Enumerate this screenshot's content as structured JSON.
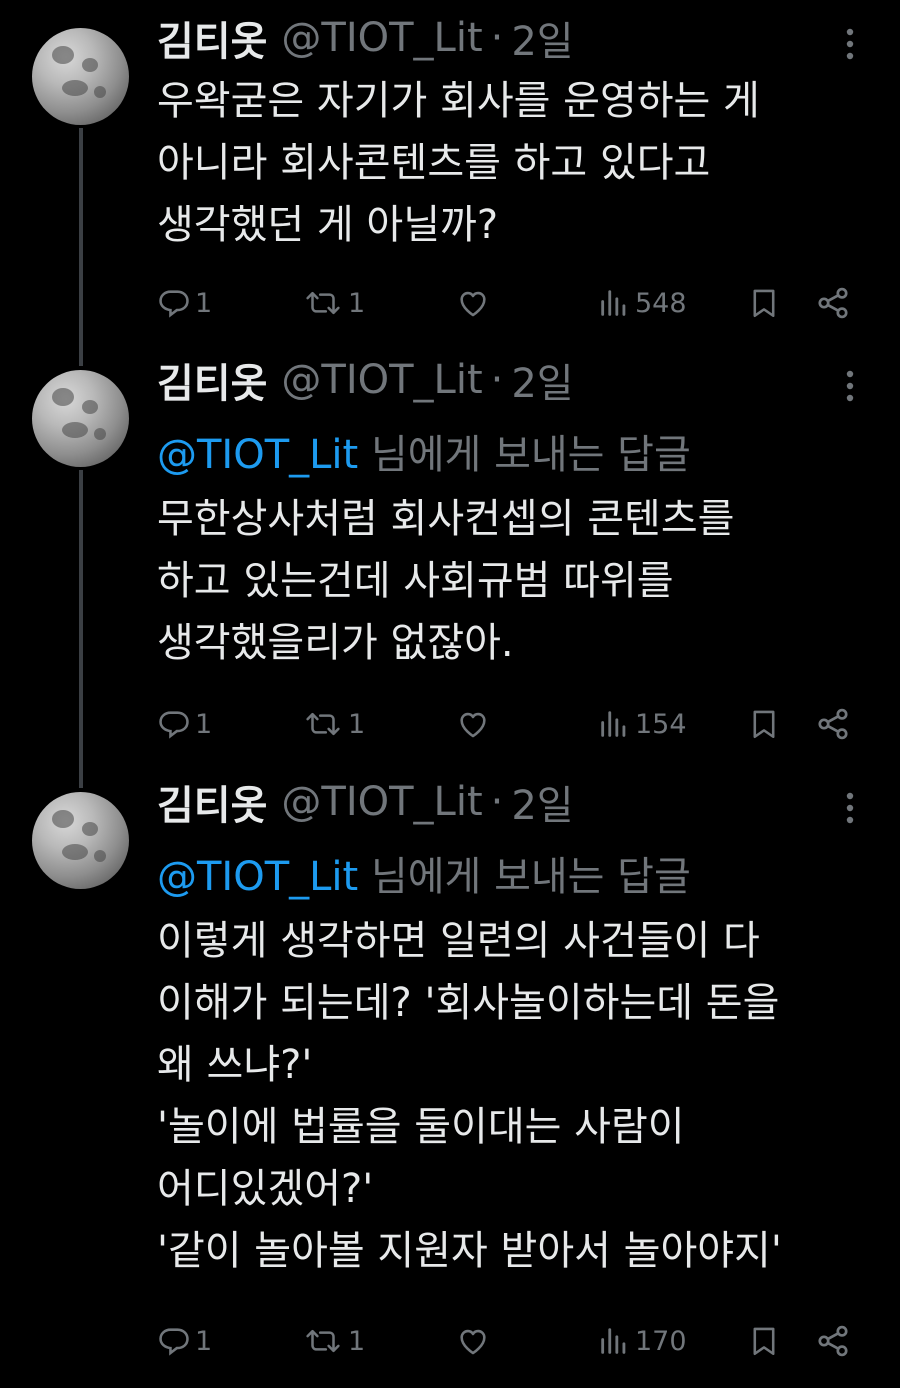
{
  "tweets": [
    {
      "name": "김티옷",
      "handle": "@TIOT_Lit",
      "time": "2일",
      "reply_mention": "",
      "reply_suffix": "",
      "lines": [
        "우왁굳은 자기가 회사를 운영하는 게",
        "아니라 회사콘텐츠를 하고 있다고",
        "생각했던 게 아닐까?"
      ],
      "replies": "1",
      "retweets": "1",
      "views": "548"
    },
    {
      "name": "김티옷",
      "handle": "@TIOT_Lit",
      "time": "2일",
      "reply_mention": "@TIOT_Lit",
      "reply_suffix": "님에게 보내는 답글",
      "lines": [
        "무한상사처럼 회사컨셉의 콘텐츠를",
        "하고 있는건데 사회규범 따위를",
        "생각했을리가 없잖아."
      ],
      "replies": "1",
      "retweets": "1",
      "views": "154"
    },
    {
      "name": "김티옷",
      "handle": "@TIOT_Lit",
      "time": "2일",
      "reply_mention": "@TIOT_Lit",
      "reply_suffix": "님에게 보내는 답글",
      "lines": [
        "이렇게 생각하면 일련의 사건들이 다",
        "이해가 되는데? '회사놀이하는데 돈을",
        "왜 쓰냐?'",
        "'놀이에 법률을 둘이대는 사람이",
        "어디있겠어?'",
        "'같이 놀아볼 지원자 받아서 놀아야지'"
      ],
      "replies": "1",
      "retweets": "1",
      "views": "170"
    }
  ],
  "separator_dot": "·",
  "colors": {
    "background": "#000000",
    "text": "#e7e9ea",
    "muted": "#71767b",
    "mention": "#1d9bf0"
  },
  "icons": [
    "more-icon",
    "reply-icon",
    "retweet-icon",
    "like-icon",
    "views-icon",
    "bookmark-icon",
    "share-icon"
  ]
}
